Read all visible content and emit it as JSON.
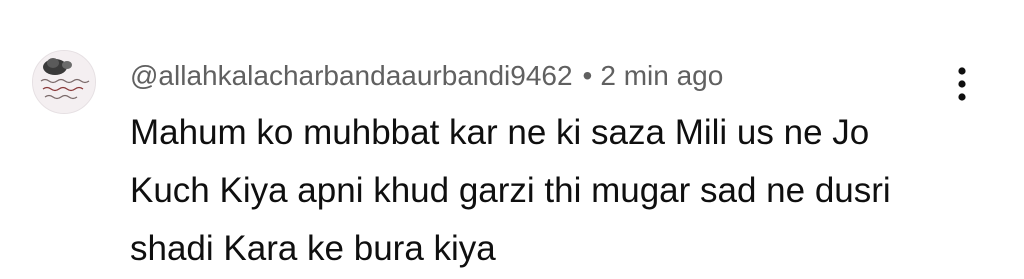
{
  "comment": {
    "author": "@allahkalacharbandaaurbandi9462",
    "separator": "•",
    "timestamp": "2 min ago",
    "text_lines": [
      "Mahum ko muhbbat kar ne ki saza Mili us ne Jo",
      "Kuch Kiya apni khud garzi thi mugar sad ne dusri",
      "shadi Kara ke bura kiya"
    ],
    "avatar_icon": "avatar-image",
    "menu_icon": "more-vert-icon"
  },
  "colors": {
    "author_text": "#606060",
    "body_text": "#0f0f0f",
    "background": "#ffffff"
  }
}
